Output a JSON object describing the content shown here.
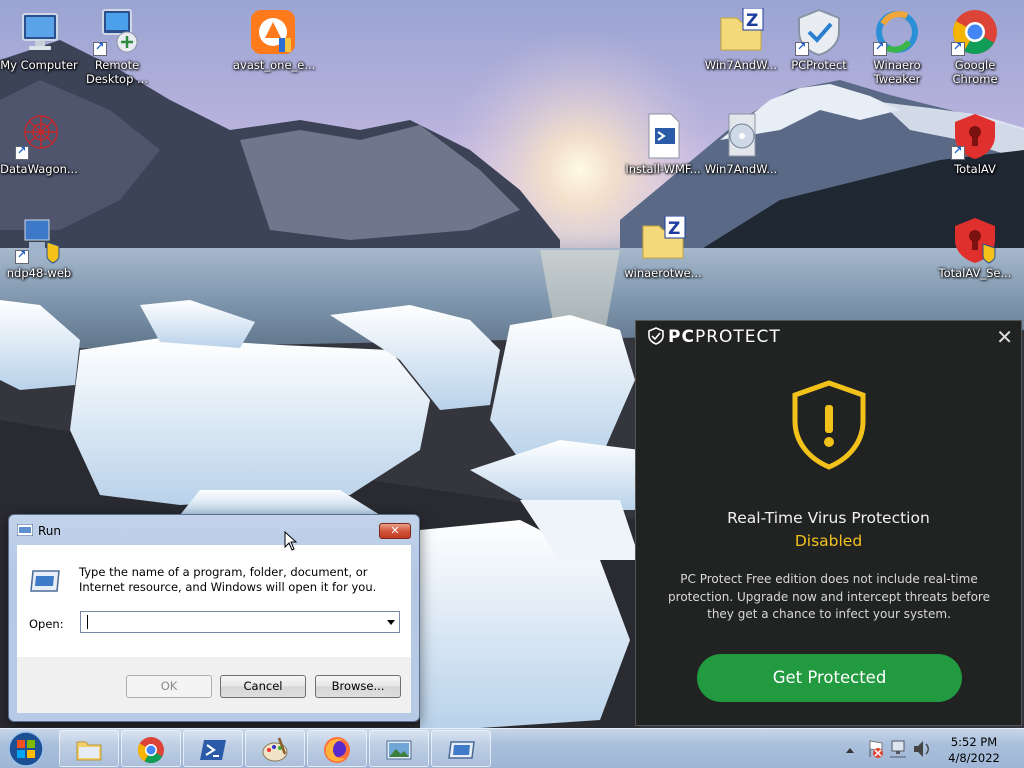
{
  "desktop": {
    "icons": [
      {
        "label": "My Computer"
      },
      {
        "label": "Remote Desktop ..."
      },
      {
        "label": "avast_one_e..."
      },
      {
        "label": "Win7AndW..."
      },
      {
        "label": "PCProtect"
      },
      {
        "label": "Winaero Tweaker"
      },
      {
        "label": "Google Chrome"
      },
      {
        "label": "DataWagon..."
      },
      {
        "label": "Install-WMF..."
      },
      {
        "label": "Win7AndW..."
      },
      {
        "label": "TotalAV"
      },
      {
        "label": "ndp48-web"
      },
      {
        "label": "winaerotwe..."
      },
      {
        "label": "TotalAV_Se..."
      }
    ]
  },
  "run_dialog": {
    "title": "Run",
    "close_label": "✕",
    "description": "Type the name of a program, folder, document, or Internet resource, and Windows will open it for you.",
    "open_label": "Open:",
    "open_value": "",
    "ok_label": "OK",
    "cancel_label": "Cancel",
    "browse_label": "Browse..."
  },
  "pcprotect_popup": {
    "brand_pc": "PC",
    "brand_rest": "PROTECT",
    "close_label": "✕",
    "heading": "Real-Time Virus Protection",
    "status": "Disabled",
    "message": "PC Protect Free edition does not include real-time protection. Upgrade now and intercept threats before they get a chance to infect your system.",
    "cta_label": "Get Protected",
    "colors": {
      "background": "#212323",
      "warning": "#f2c21b",
      "cta": "#229a3f"
    }
  },
  "taskbar": {
    "items": [
      "start-orb",
      "explorer",
      "chrome",
      "powershell",
      "paint",
      "firefox",
      "photo-viewer",
      "run"
    ],
    "clock": {
      "time": "5:52 PM",
      "date": "4/8/2022"
    }
  }
}
